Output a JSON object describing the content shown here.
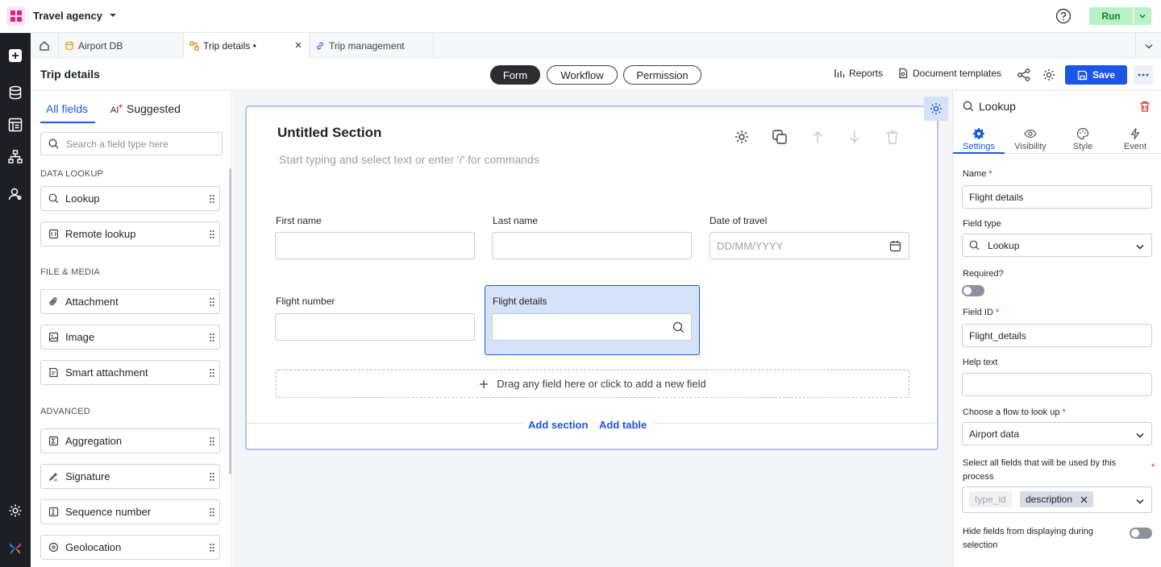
{
  "app": {
    "title": "Travel agency",
    "run_label": "Run"
  },
  "tabs": [
    {
      "label": "Airport DB"
    },
    {
      "label": "Trip details •"
    },
    {
      "label": "Trip management"
    }
  ],
  "header": {
    "title": "Trip details",
    "modes": [
      "Form",
      "Workflow",
      "Permission"
    ],
    "active_mode": "Form",
    "reports_label": "Reports",
    "doc_templates_label": "Document templates",
    "save_label": "Save"
  },
  "fields_panel": {
    "tabs": [
      "All fields",
      "Suggested"
    ],
    "search_placeholder": "Search a field type here",
    "groups": {
      "data_lookup": "DATA LOOKUP",
      "file_media": "FILE & MEDIA",
      "advanced": "ADVANCED"
    },
    "items": {
      "lookup": "Lookup",
      "remote_lookup": "Remote lookup",
      "attachment": "Attachment",
      "image": "Image",
      "smart_attachment": "Smart attachment",
      "aggregation": "Aggregation",
      "signature": "Signature",
      "sequence_number": "Sequence number",
      "geolocation": "Geolocation"
    }
  },
  "canvas": {
    "section_title": "Untitled Section",
    "section_placeholder": "Start typing and select text or enter '/' for commands",
    "fields": {
      "first_name": "First name",
      "last_name": "Last name",
      "date_of_travel": "Date of travel",
      "date_placeholder": "DD/MM/YYYY",
      "flight_number": "Flight number",
      "flight_details": "Flight details"
    },
    "dropzone": "Drag any field here or click to add a new field",
    "add_section": "Add section",
    "add_table": "Add table"
  },
  "properties": {
    "title": "Lookup",
    "tabs": [
      "Settings",
      "Visibility",
      "Style",
      "Event"
    ],
    "active_tab": "Settings",
    "name_label": "Name",
    "name_value": "Flight details",
    "field_type_label": "Field type",
    "field_type_value": "Lookup",
    "required_label": "Required?",
    "required_on": false,
    "field_id_label": "Field ID",
    "field_id_value": "Flight_details",
    "help_text_label": "Help text",
    "help_text_value": "",
    "flow_label": "Choose a flow to look up",
    "flow_value": "Airport data",
    "select_fields_label": "Select all fields that will be used by this process",
    "selected_chips": [
      "type_id",
      "description"
    ],
    "hide_fields_label": "Hide fields from displaying during selection",
    "hide_fields_on": false
  },
  "colors": {
    "accent": "#1a56e8",
    "run_bg": "#b9f2c7",
    "rail_bg": "#1e1f24"
  }
}
